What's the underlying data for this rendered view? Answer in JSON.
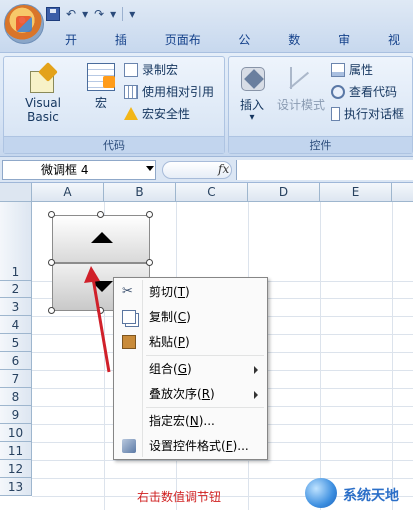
{
  "quick_access": {
    "undo_glyph": "↶",
    "redo_glyph": "↷",
    "customize_glyph": "▾"
  },
  "tabs": [
    "开始",
    "插入",
    "页面布局",
    "公式",
    "数据",
    "审阅",
    "视"
  ],
  "ribbon": {
    "code_group": {
      "label": "代码",
      "visual_basic": "Visual Basic",
      "macros": "宏",
      "record_macro": "录制宏",
      "relative_refs": "使用相对引用",
      "macro_security": "宏安全性"
    },
    "controls_group": {
      "label": "控件",
      "insert": "插入",
      "insert_dropdown": "▾",
      "design_mode": "设计模式",
      "properties": "属性",
      "view_code": "查看代码",
      "run_dialog": "执行对话框"
    }
  },
  "formula_bar": {
    "name_box": "微调框 4",
    "fx_label": "fx",
    "formula": ""
  },
  "sheet": {
    "columns": [
      "A",
      "B",
      "C",
      "D",
      "E"
    ],
    "rows": [
      "1",
      "2",
      "3",
      "4",
      "5",
      "6",
      "7",
      "8",
      "9",
      "10",
      "11",
      "12",
      "13"
    ]
  },
  "context_menu": {
    "items": [
      {
        "label": "剪切",
        "key": "T",
        "icon": "scissors-icon"
      },
      {
        "label": "复制",
        "key": "C",
        "icon": "copy-icon"
      },
      {
        "label": "粘贴",
        "key": "P",
        "icon": "paste-icon"
      },
      {
        "label": "组合",
        "key": "G",
        "submenu": true
      },
      {
        "label": "叠放次序",
        "key": "R",
        "submenu": true
      },
      {
        "label": "指定宏",
        "key": "N",
        "suffix": "..."
      },
      {
        "label": "设置控件格式",
        "key": "F",
        "suffix": "...",
        "icon": "format-control-icon"
      }
    ]
  },
  "caption": "右击数值调节钮",
  "watermark": {
    "text": "系统天地"
  },
  "colors": {
    "annotation_arrow": "#d0202a",
    "caption": "#d02020",
    "accent": "#15428b"
  }
}
